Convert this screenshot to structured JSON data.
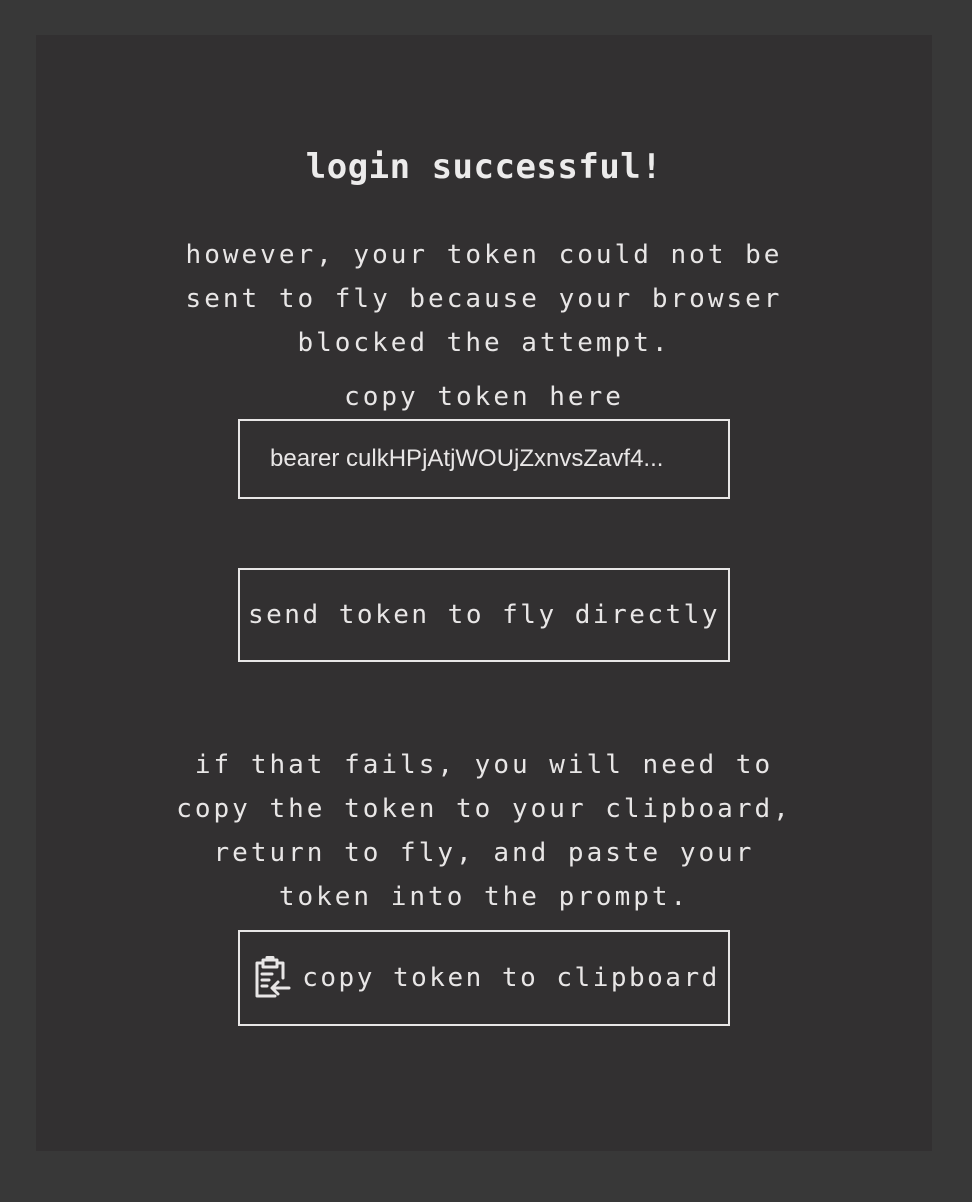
{
  "page": {
    "title": "login successful!",
    "message": "however, your token could not be sent to fly because your browser blocked the attempt.",
    "copy_hint": "copy token here",
    "fallback_message": "if that fails, you will need to copy the token to your clipboard, return to fly, and paste your token into the prompt."
  },
  "token_field": {
    "value": "bearer culkHPjAtjWOUjZxnvsZavf4..."
  },
  "actions": {
    "send_label": "send token to fly directly",
    "copy_label": "copy token to clipboard",
    "copy_icon": "clipboard-paste-icon"
  },
  "colors": {
    "background": "#383838",
    "panel": "#323031",
    "foreground": "#e8e6e6"
  }
}
